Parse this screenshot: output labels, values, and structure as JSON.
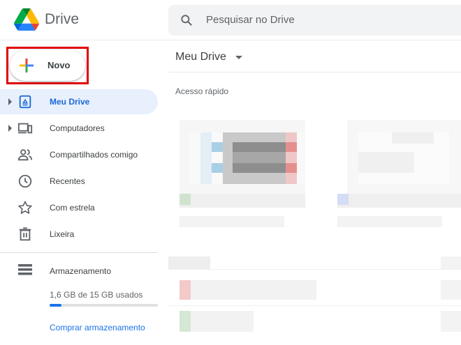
{
  "header": {
    "app_title": "Drive",
    "search_placeholder": "Pesquisar no Drive"
  },
  "sidebar": {
    "new_button_label": "Novo",
    "items": [
      {
        "label": "Meu Drive",
        "icon": "my-drive-icon",
        "active": true,
        "expandable": true
      },
      {
        "label": "Computadores",
        "icon": "computers-icon",
        "active": false,
        "expandable": true
      },
      {
        "label": "Compartilhados comigo",
        "icon": "shared-icon",
        "active": false,
        "expandable": false
      },
      {
        "label": "Recentes",
        "icon": "clock-icon",
        "active": false,
        "expandable": false
      },
      {
        "label": "Com estrela",
        "icon": "star-icon",
        "active": false,
        "expandable": false
      },
      {
        "label": "Lixeira",
        "icon": "trash-icon",
        "active": false,
        "expandable": false
      }
    ],
    "storage": {
      "title": "Armazenamento",
      "used_text": "1,6 GB de 15 GB usados",
      "used_fraction": 0.11,
      "buy_label": "Comprar armazenamento"
    }
  },
  "main": {
    "title": "Meu Drive",
    "quick_access_label": "Acesso rápido"
  },
  "colors": {
    "accent": "#1a73e8",
    "active_bg": "#e8f0fe",
    "highlight": "#e00000"
  }
}
